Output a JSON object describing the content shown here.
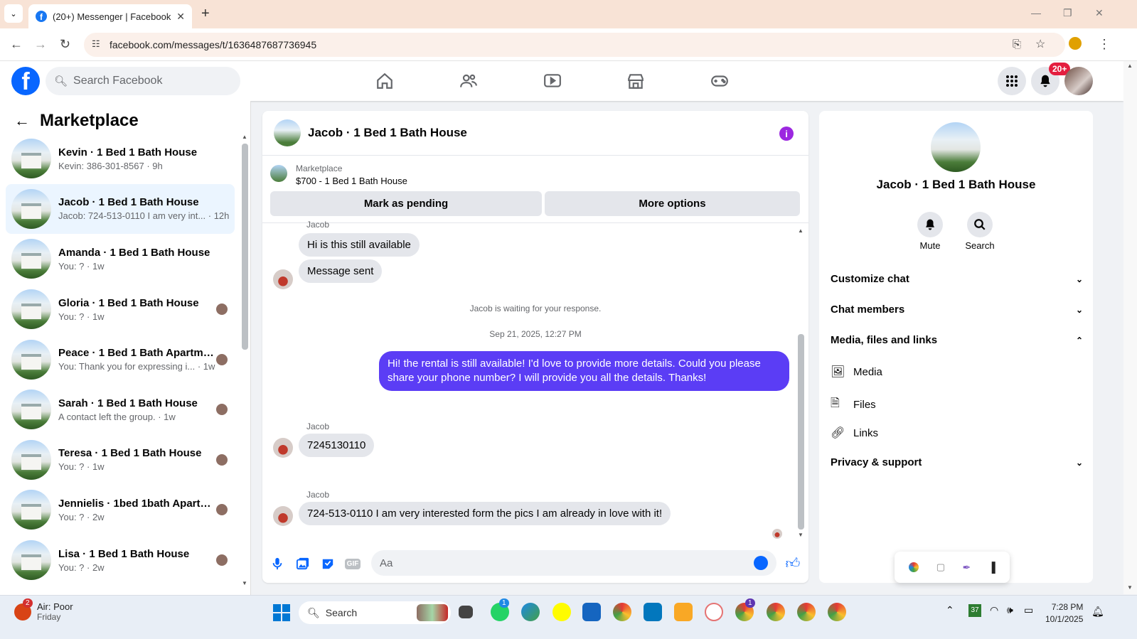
{
  "browser": {
    "tab_title": "(20+) Messenger | Facebook",
    "url": "facebook.com/messages/t/1636487687736945"
  },
  "fb": {
    "search_placeholder": "Search Facebook",
    "notif_badge": "20+"
  },
  "sidebar": {
    "title": "Marketplace",
    "conversations": [
      {
        "name": "Kevin · 1 Bed 1 Bath House",
        "preview": "Kevin: 386-301-8567 · 9h",
        "active": false
      },
      {
        "name": "Jacob · 1 Bed 1 Bath House",
        "preview": "Jacob: 724-513-0110 I am very int... · 12h",
        "active": true
      },
      {
        "name": "Amanda · 1 Bed 1 Bath House",
        "preview": "You: ? · 1w",
        "active": false
      },
      {
        "name": "Gloria · 1 Bed 1 Bath House",
        "preview": "You: ? · 1w",
        "active": false
      },
      {
        "name": "Peace · 1 Bed 1 Bath Apartme...",
        "preview": "You: Thank you for expressing i... · 1w",
        "active": false
      },
      {
        "name": "Sarah · 1 Bed 1 Bath House",
        "preview": "A contact left the group. · 1w",
        "active": false
      },
      {
        "name": "Teresa · 1 Bed 1 Bath House",
        "preview": "You: ? · 1w",
        "active": false
      },
      {
        "name": "Jennielis · 1bed 1bath Apartm...",
        "preview": "You: ? · 2w",
        "active": false
      },
      {
        "name": "Lisa · 1 Bed 1 Bath House",
        "preview": "You: ? · 2w",
        "active": false
      }
    ]
  },
  "chat": {
    "title": "Jacob · 1 Bed 1 Bath House",
    "marketplace_label": "Marketplace",
    "listing": "$700 - 1 Bed 1 Bath House",
    "mark_pending": "Mark as pending",
    "more_options": "More options",
    "sender_name": "Jacob",
    "msg1": "Hi is this still available",
    "msg2": "Message sent",
    "waiting": "Jacob is waiting for your response.",
    "timestamp": "Sep 21, 2025, 12:27 PM",
    "my_msg": "Hi! the rental is still available! I'd love to provide more details. Could you please share your phone number? I will provide you all the details. Thanks!",
    "msg3": "7245130110",
    "msg4": "724-513-0110 I am very interested form the pics I am already in love with it!",
    "composer_placeholder": "Aa"
  },
  "info": {
    "name": "Jacob · 1 Bed 1 Bath House",
    "mute": "Mute",
    "search": "Search",
    "customize": "Customize chat",
    "members": "Chat members",
    "media_files_links": "Media, files and links",
    "media": "Media",
    "files": "Files",
    "links": "Links",
    "privacy": "Privacy & support"
  },
  "taskbar": {
    "weather_line1": "Air: Poor",
    "weather_line2": "Friday",
    "search": "Search",
    "time": "7:28 PM",
    "date": "10/1/2025",
    "weather_badge": "2",
    "whatsapp_badge": "1",
    "chrome_badge": "1",
    "calendar_day": "37"
  }
}
